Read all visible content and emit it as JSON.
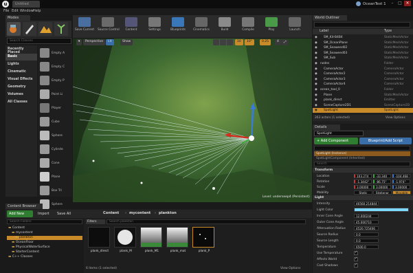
{
  "window": {
    "tab_label": "Untitled",
    "project": "OceanTest 1"
  },
  "menu": [
    "File",
    "Edit",
    "Window",
    "Help"
  ],
  "modes": {
    "title": "Modes",
    "search_placeholder": "Search Classes",
    "categories": [
      "Recently Placed",
      "Basic",
      "Lights",
      "Cinematic",
      "Visual Effects",
      "Geometry",
      "Volumes",
      "All Classes"
    ],
    "selected_category": "Basic",
    "items": [
      "Empty A",
      "Empty C",
      "Empty P",
      "Point Li",
      "Player",
      "Cube",
      "Sphere",
      "Cylinde",
      "Cone",
      "Plane",
      "Box Tri",
      "Sphere"
    ]
  },
  "toolbar": {
    "buttons": [
      "Save Current",
      "Source Control",
      "Content",
      "Settings",
      "Blueprints",
      "Cinematics",
      "Build",
      "Compile",
      "Play",
      "Launch"
    ]
  },
  "viewport": {
    "view_mode_perspective": "Perspective",
    "view_mode_lit": "Lit",
    "show": "Show",
    "snap_grid": "10",
    "snap_angle": "10°",
    "snap_scale": "0.25",
    "camera_speed": "4",
    "level_label": "Level:  underseep4 (Persistent)"
  },
  "outliner": {
    "title": "World Outliner",
    "col_label": "Label",
    "col_type": "Type",
    "rows": [
      {
        "label": "SM_Kit-B4B4",
        "type": "StaticMeshActor",
        "indent": 2
      },
      {
        "label": "SM_OceanPlane",
        "type": "StaticMeshActor",
        "indent": 2
      },
      {
        "label": "SM_Seaweed02",
        "type": "StaticMeshActor",
        "indent": 2
      },
      {
        "label": "SM_Seaweed03",
        "type": "StaticMeshActor",
        "indent": 2
      },
      {
        "label": "SM_Sub",
        "type": "StaticMeshActor",
        "indent": 2
      },
      {
        "label": "nodes",
        "type": "Folder",
        "indent": 1
      },
      {
        "label": "CameraActor",
        "type": "CameraActor",
        "indent": 2
      },
      {
        "label": "CameraActor2",
        "type": "CameraActor",
        "indent": 2
      },
      {
        "label": "CameraActor3",
        "type": "CameraActor",
        "indent": 2
      },
      {
        "label": "CameraActor4",
        "type": "CameraActor",
        "indent": 2
      },
      {
        "label": "ocean_tool_0",
        "type": "Folder",
        "indent": 1
      },
      {
        "label": "Plane",
        "type": "StaticMeshActor",
        "indent": 2
      },
      {
        "label": "plank_direct",
        "type": "Emitter",
        "indent": 2
      },
      {
        "label": "SceneCapture2D1",
        "type": "SceneCapture2D",
        "indent": 2
      },
      {
        "label": "SpotLight",
        "type": "SpotLight",
        "indent": 2,
        "selected": true
      }
    ],
    "footer": "263 actors (1 selected)",
    "view_options": "View Options"
  },
  "details": {
    "title": "Details",
    "actor_name": "SpotLight",
    "add_component": "+ Add Component",
    "blueprint_btn": "Blueprint/Add Script",
    "component_row": "SpotLight (Instance)",
    "component_row2": "SpotLightComponent (Inherited)",
    "search_placeholder": "Search",
    "transform": "Transform",
    "location": {
      "label": "Location",
      "x": "103.274",
      "y": "-33.340",
      "z": "-104.468"
    },
    "rotation": {
      "label": "Rotation",
      "x": "-1.3442°",
      "y": "-86.75°",
      "z": "-1.974°"
    },
    "scale": {
      "label": "Scale",
      "x": "3.00000",
      "y": "3.00000",
      "z": "3.00000"
    },
    "mobility": {
      "label": "Mobility",
      "options": [
        "Static",
        "Stationar",
        "Movable"
      ],
      "selected": "Movable"
    },
    "light_section": "Light",
    "props": [
      {
        "label": "Intensity",
        "value": "46560.214844"
      },
      {
        "label": "Light Color",
        "value": ""
      },
      {
        "label": "Inner Cone Angle",
        "value": "12.000244"
      },
      {
        "label": "Outer Cone Angle",
        "value": "45.000710"
      },
      {
        "label": "Attenuation Radius",
        "value": "4520.725406"
      },
      {
        "label": "Source Radius",
        "value": "0.0"
      },
      {
        "label": "Source Length",
        "value": "0.0"
      },
      {
        "label": "Temperature",
        "value": "6500.0"
      },
      {
        "label": "Use Temperature",
        "value": ""
      },
      {
        "label": "Affects World",
        "value": ""
      },
      {
        "label": "Cast Shadows",
        "value": ""
      }
    ],
    "colors": {
      "light_color": "#7fd8ff",
      "accent": "#c98b2a"
    }
  },
  "content_browser": {
    "title": "Content Browser",
    "add_new": "Add New",
    "import": "Import",
    "save_all": "Save All",
    "crumbs": [
      "Content",
      "mycontent",
      "plankton"
    ],
    "filters": "Filters",
    "search_placeholder": "Search plankton",
    "tree_search": "Search Folders",
    "tree": [
      {
        "label": "Content",
        "indent": 0
      },
      {
        "label": "mycontent",
        "indent": 1
      },
      {
        "label": "plankton",
        "indent": 2,
        "selected": true
      },
      {
        "label": "OceanFloor",
        "indent": 1
      },
      {
        "label": "PhysicalWaterSurface",
        "indent": 1
      },
      {
        "label": "StarterContent",
        "indent": 1
      },
      {
        "label": "C++ Classes",
        "indent": 0
      }
    ],
    "assets": [
      {
        "label": "plank_direct",
        "kind": "emitter"
      },
      {
        "label": "plank_M",
        "kind": "sphere"
      },
      {
        "label": "plank_M1",
        "kind": "gradient"
      },
      {
        "label": "plank_mat",
        "kind": "gradient"
      },
      {
        "label": "plank_P",
        "kind": "particle"
      }
    ],
    "footer": "6 items (1 selected)",
    "view_options": "View Options"
  }
}
